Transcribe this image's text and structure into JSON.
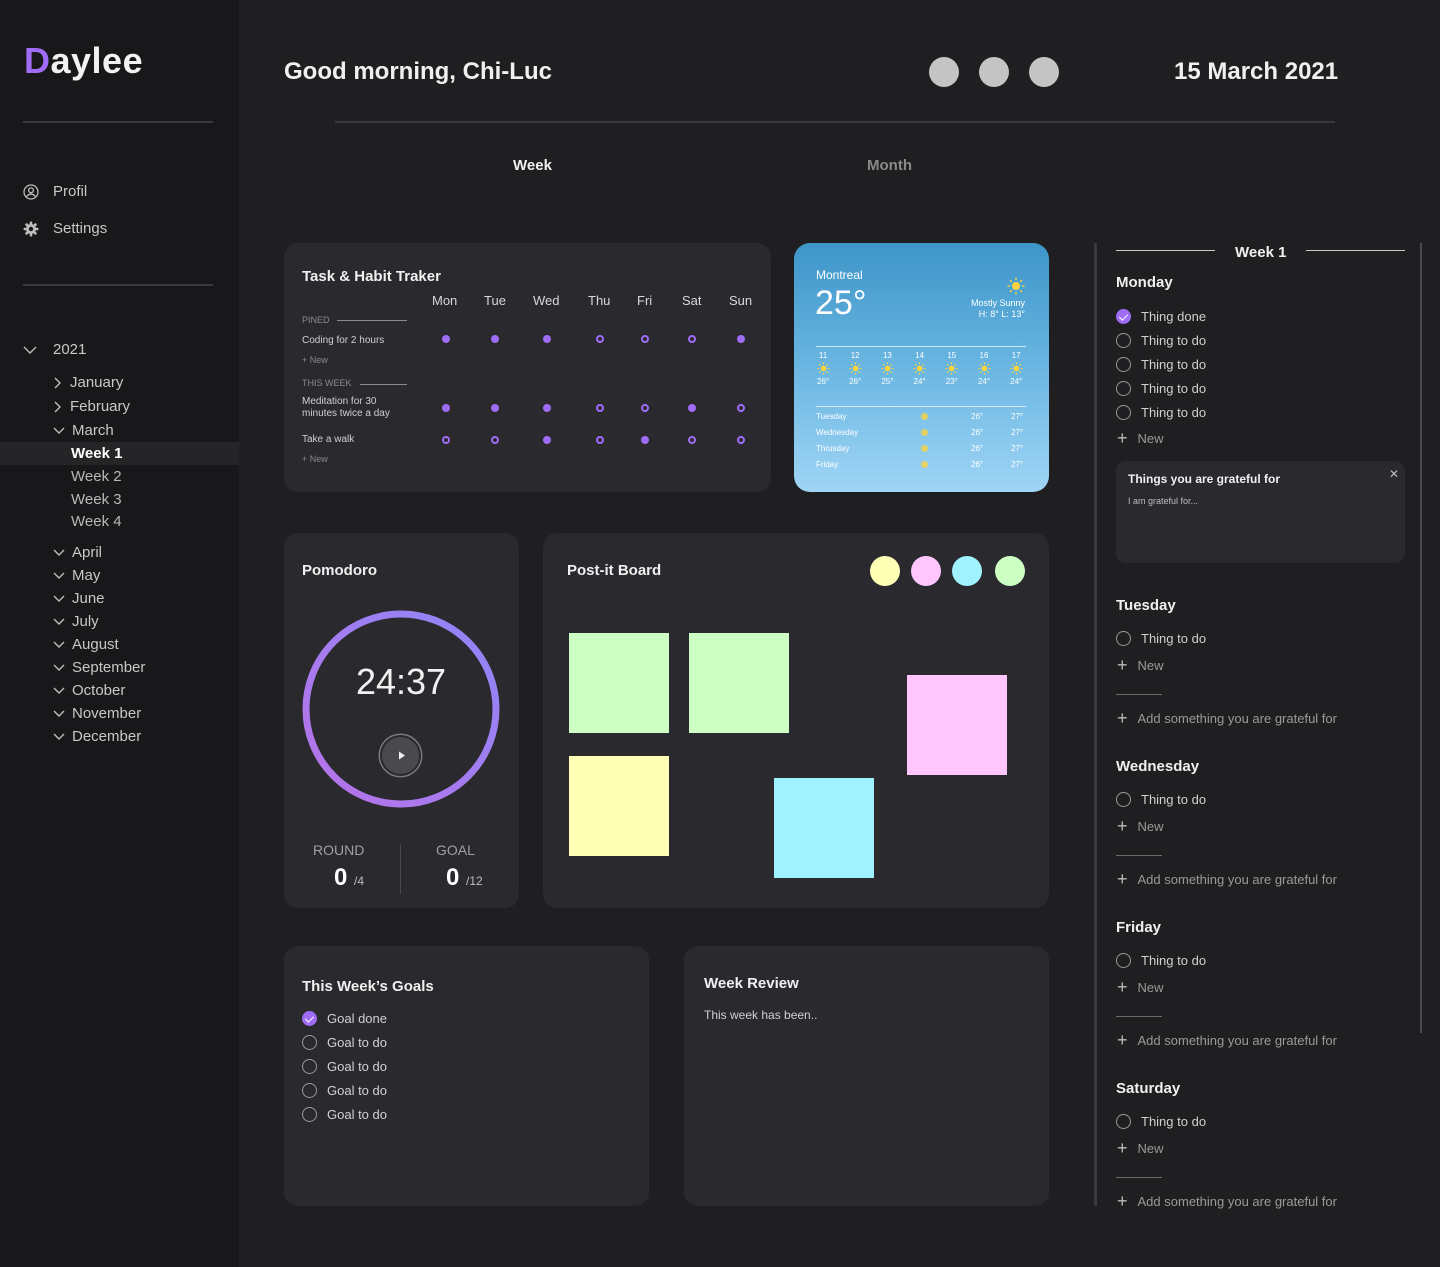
{
  "app": {
    "logo_first": "D",
    "logo_rest": "aylee"
  },
  "nav": {
    "profil": "Profil",
    "settings": "Settings"
  },
  "calendar": {
    "year": "2021",
    "months_before": [
      "January",
      "February"
    ],
    "current_month": "March",
    "weeks": [
      "Week 1",
      "Week 2",
      "Week 3",
      "Week 4"
    ],
    "months_after": [
      "April",
      "May",
      "June",
      "July",
      "August",
      "September",
      "October",
      "November",
      "December"
    ]
  },
  "header": {
    "greeting": "Good morning, Chi-Luc",
    "date": "15 March 2021"
  },
  "tabs": {
    "week": "Week",
    "month": "Month"
  },
  "habit": {
    "title": "Task & Habit Traker",
    "days": [
      "Mon",
      "Tue",
      "Wed",
      "Thu",
      "Fri",
      "Sat",
      "Sun"
    ],
    "pined": "PINED",
    "this_week": "THIS WEEK",
    "new": "New",
    "rows": [
      {
        "label": "Coding for 2 hours",
        "marks": [
          1,
          1,
          1,
          0,
          0,
          0,
          1
        ]
      },
      {
        "label": "Meditation for 30 minutes twice a day",
        "marks": [
          1,
          1,
          1,
          0,
          0,
          1,
          0
        ]
      },
      {
        "label": "Take a walk",
        "marks": [
          0,
          0,
          1,
          0,
          1,
          0,
          0
        ]
      }
    ]
  },
  "weather": {
    "city": "Montreal",
    "temp": "25°",
    "cond": "Mostly Sunny",
    "hl": "H: 8° L: 13°",
    "hours": [
      "11",
      "12",
      "13",
      "14",
      "15",
      "16",
      "17"
    ],
    "hour_temps": [
      "26°",
      "26°",
      "25°",
      "24°",
      "23°",
      "24°",
      "24°"
    ],
    "days": [
      {
        "name": "Tuesday",
        "hi": "26°",
        "lo": "27°"
      },
      {
        "name": "Wednesday",
        "hi": "26°",
        "lo": "27°"
      },
      {
        "name": "Thrusday",
        "hi": "26°",
        "lo": "27°"
      },
      {
        "name": "Friday",
        "hi": "26°",
        "lo": "27°"
      }
    ]
  },
  "pomodoro": {
    "title": "Pomodoro",
    "time": "24:37",
    "round_label": "ROUND",
    "round": "0",
    "round_total": "/4",
    "goal_label": "GOAL",
    "goal": "0",
    "goal_total": "/12"
  },
  "postit": {
    "title": "Post-it Board",
    "colors": [
      "#ffffb5",
      "#ffc6fd",
      "#a0f2fe",
      "#cdfec4"
    ]
  },
  "goals": {
    "title": "This Week’s Goals",
    "items": [
      {
        "label": "Goal done",
        "done": true
      },
      {
        "label": "Goal to do",
        "done": false
      },
      {
        "label": "Goal to do",
        "done": false
      },
      {
        "label": "Goal to do",
        "done": false
      },
      {
        "label": "Goal to do",
        "done": false
      }
    ]
  },
  "review": {
    "title": "Week Review",
    "text": "This week has been.."
  },
  "planner": {
    "title": "Week 1",
    "new": "New",
    "add_grateful": "Add something you are grateful for",
    "grateful_title": "Things you are grateful for",
    "grateful_placeholder": "I am grateful for...",
    "monday": {
      "name": "Monday",
      "items": [
        {
          "label": "Thing done",
          "done": true
        },
        {
          "label": "Thing to do",
          "done": false
        },
        {
          "label": "Thing to do",
          "done": false
        },
        {
          "label": "Thing to do",
          "done": false
        },
        {
          "label": "Thing to do",
          "done": false
        }
      ]
    },
    "tuesday": {
      "name": "Tuesday",
      "item": "Thing to do"
    },
    "wednesday": {
      "name": "Wednesday",
      "item": "Thing to do"
    },
    "friday": {
      "name": "Friday",
      "item": "Thing to do"
    },
    "saturday": {
      "name": "Saturday",
      "item": "Thing to do"
    }
  }
}
